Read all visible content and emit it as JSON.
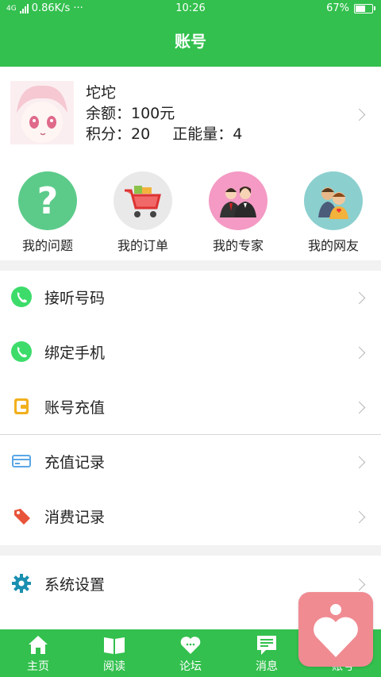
{
  "status_bar": {
    "network": "4G",
    "speed": "0.86K/s",
    "dots": "···",
    "time": "10:26",
    "battery": "67%",
    "battery_level": 0.67
  },
  "header": {
    "title": "账号"
  },
  "profile": {
    "name": "坨坨",
    "balance": "余额：100元",
    "points": "积分：20",
    "energy": "正能量：4"
  },
  "quick_actions": [
    {
      "label": "我的问题",
      "icon": "question-icon",
      "color": "#5ccb8a"
    },
    {
      "label": "我的订单",
      "icon": "shopping-cart-icon",
      "color": "#e9e9e9"
    },
    {
      "label": "我的专家",
      "icon": "experts-icon",
      "color": "#f49ac4"
    },
    {
      "label": "我的网友",
      "icon": "friends-icon",
      "color": "#8ccfcf"
    }
  ],
  "menu": [
    {
      "label": "接听号码",
      "icon": "phone-icon"
    },
    {
      "label": "绑定手机",
      "icon": "phone-icon"
    },
    {
      "label": "账号充值",
      "icon": "wallet-icon"
    },
    {
      "label": "充值记录",
      "icon": "card-icon"
    },
    {
      "label": "消费记录",
      "icon": "tag-icon"
    },
    {
      "label": "系统设置",
      "icon": "gear-icon"
    }
  ],
  "tabs": [
    {
      "label": "主页",
      "icon": "home-icon"
    },
    {
      "label": "阅读",
      "icon": "book-icon"
    },
    {
      "label": "论坛",
      "icon": "heart-chat-icon"
    },
    {
      "label": "消息",
      "icon": "message-icon"
    },
    {
      "label": "账号",
      "icon": "account-icon"
    }
  ],
  "colors": {
    "primary": "#33c04e",
    "fab": "#f08b92"
  }
}
